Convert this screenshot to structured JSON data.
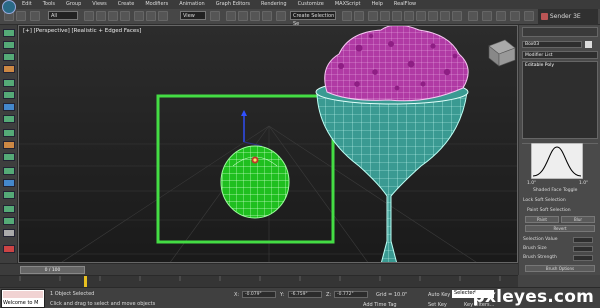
{
  "menubar": {
    "items": [
      "Edit",
      "Tools",
      "Group",
      "Views",
      "Create",
      "Modifiers",
      "Animation",
      "Graph Editors",
      "Rendering",
      "Customize",
      "MAXScript",
      "Help",
      "RealFlow"
    ]
  },
  "toolbar": {
    "selection_filter": "All",
    "view_dropdown": "View",
    "named_selection": "Create Selection Se",
    "search_label": "Sender 3E"
  },
  "viewport": {
    "label": "[+] [Perspective] [Realistic + Edged Faces]"
  },
  "command_panel": {
    "object_name": "Box03",
    "modifier_list": "Modifier List",
    "stack_item": "Editable Poly",
    "falloff_left": "1.0\"",
    "falloff_right": "1.0\"",
    "shaded_face_toggle": "Shaded Face Toggle",
    "lock_soft": "Lock Soft Selection",
    "paint_soft": "Paint Soft Selection",
    "paint_btn": "Paint",
    "blur_btn": "Blur",
    "revert_btn": "Revert",
    "selection_value": "Selection Value",
    "brush_size": "Brush Size",
    "brush_strength": "Brush Strength",
    "brush_options": "Brush Options"
  },
  "timeline": {
    "slider": "0 / 100"
  },
  "status": {
    "maxscript_text": "Welcome to M",
    "selected_count": "1 Object Selected",
    "prompt": "Click and drag to select and move objects",
    "x_label": "X:",
    "x_value": "-0.079\"",
    "y_label": "Y:",
    "y_value": "-6.759\"",
    "z_label": "Z:",
    "z_value": "-0.772\"",
    "grid": "Grid = 10.0\"",
    "auto_key": "Auto Key",
    "set_key": "Set Key",
    "selected_dropdown": "Selected",
    "key_filters": "Key Filters...",
    "add_time_tag": "Add Time Tag"
  },
  "watermark": "pxleyes.com",
  "colors": {
    "apple_wire": "#55ff55",
    "glass_wire": "#4fe0d0",
    "ice_cream": "#c040b0",
    "selection_box": "#44dd44"
  }
}
